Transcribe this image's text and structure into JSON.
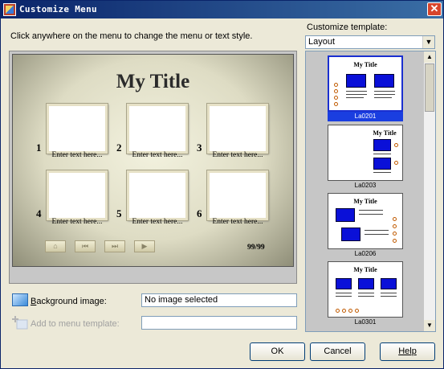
{
  "window": {
    "title": "Customize Menu",
    "close_glyph": "✕"
  },
  "instruction": "Click anywhere on the menu to change the menu or text style.",
  "template": {
    "label": "Customize template:",
    "selected": "Layout"
  },
  "preview": {
    "title": "My Title",
    "items": [
      {
        "num": "1",
        "text": "Enter text here..."
      },
      {
        "num": "2",
        "text": "Enter text here..."
      },
      {
        "num": "3",
        "text": "Enter text here..."
      },
      {
        "num": "4",
        "text": "Enter text here..."
      },
      {
        "num": "5",
        "text": "Enter text here..."
      },
      {
        "num": "6",
        "text": "Enter text here..."
      }
    ],
    "page_count": "99/99"
  },
  "background": {
    "label_underlined": "B",
    "label_rest": "ackground image:",
    "value": "No image selected"
  },
  "add_template": {
    "label": "Add to menu template:",
    "value": ""
  },
  "templates": [
    {
      "name": "La0201",
      "title": "My Title"
    },
    {
      "name": "La0203",
      "title": "My Title"
    },
    {
      "name": "La0206",
      "title": "My Title"
    },
    {
      "name": "La0301",
      "title": "My Title"
    }
  ],
  "buttons": {
    "ok": "OK",
    "cancel": "Cancel",
    "help": "Help"
  },
  "colors": {
    "title_bar": "#0a246a",
    "selection": "#1a3ee0",
    "thumb_fill": "#0a10d8"
  }
}
